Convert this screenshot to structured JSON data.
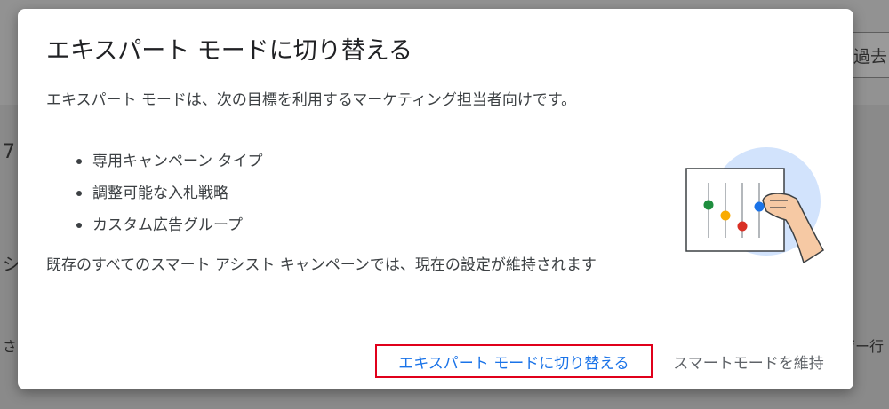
{
  "background": {
    "period_button_label": "過去",
    "fragment_number": "7",
    "fragment_si": "シ",
    "fragment_sa": "さ",
    "fragment_user": "ザー行"
  },
  "dialog": {
    "title": "エキスパート モードに切り替える",
    "description": "エキスパート モードは、次の目標を利用するマーケティング担当者向けです。",
    "features": [
      {
        "label": "専用キャンペーン タイプ"
      },
      {
        "label": "調整可能な入札戦略"
      },
      {
        "label": "カスタム広告グループ"
      }
    ],
    "note": "既存のすべてのスマート アシスト キャンペーンでは、現在の設定が維持されます",
    "illustration_icon": "slider-adjust-hand-illustration",
    "actions": {
      "primary_label": "エキスパート モードに切り替える",
      "secondary_label": "スマートモードを維持"
    }
  },
  "colors": {
    "primary_action": "#1a73e8",
    "highlight_border": "#e0001b",
    "scrim": "#8a8a8a",
    "slider_green": "#1e8e3e",
    "slider_yellow": "#f9ab00",
    "slider_red": "#d93025",
    "slider_blue": "#1a73e8"
  }
}
